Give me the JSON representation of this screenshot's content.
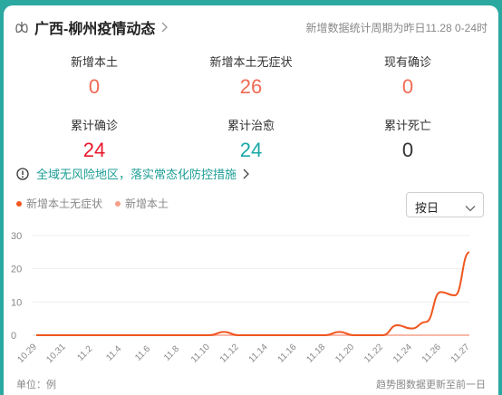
{
  "header": {
    "title": "广西-柳州疫情动态",
    "period": "新增数据统计周期为昨日11.28 0-24时"
  },
  "stats": [
    {
      "label": "新增本土",
      "value": "0",
      "color": "#f06a53"
    },
    {
      "label": "新增本土无症状",
      "value": "26",
      "color": "#f06a53"
    },
    {
      "label": "现有确诊",
      "value": "0",
      "color": "#f06a53"
    },
    {
      "label": "累计确诊",
      "value": "24",
      "color": "#e8192c"
    },
    {
      "label": "累计治愈",
      "value": "24",
      "color": "#1aa8a8"
    },
    {
      "label": "累计死亡",
      "value": "0",
      "color": "#333333"
    }
  ],
  "notice": {
    "text": "全域无风险地区，落实常态化防控措施"
  },
  "select": {
    "value": "按日"
  },
  "chart_data": {
    "type": "line",
    "x_labels": [
      "10.29",
      "10.31",
      "11.2",
      "11.4",
      "11.6",
      "11.8",
      "11.10",
      "11.12",
      "11.14",
      "11.16",
      "11.18",
      "11.20",
      "11.22",
      "11.24",
      "11.26",
      "11.27"
    ],
    "x": [
      "10.29",
      "10.30",
      "10.31",
      "11.1",
      "11.2",
      "11.3",
      "11.4",
      "11.5",
      "11.6",
      "11.7",
      "11.8",
      "11.9",
      "11.10",
      "11.11",
      "11.12",
      "11.13",
      "11.14",
      "11.15",
      "11.16",
      "11.17",
      "11.18",
      "11.19",
      "11.20",
      "11.21",
      "11.22",
      "11.23",
      "11.24",
      "11.25",
      "11.26",
      "11.27"
    ],
    "series": [
      {
        "name": "新增本土无症状",
        "color": "#f0561f",
        "values": [
          0,
          0,
          0,
          0,
          0,
          0,
          0,
          0,
          0,
          0,
          0,
          0,
          0,
          1,
          0,
          0,
          0,
          0,
          0,
          0,
          0,
          1,
          0,
          0,
          0,
          3,
          2,
          4,
          13,
          12,
          25
        ]
      },
      {
        "name": "新增本土",
        "color": "#f6a08a",
        "values": [
          0,
          0,
          0,
          0,
          0,
          0,
          0,
          0,
          0,
          0,
          0,
          0,
          0,
          0,
          0,
          0,
          0,
          0,
          0,
          0,
          0,
          0,
          0,
          0,
          0,
          0,
          0,
          0,
          0,
          0,
          0
        ]
      }
    ],
    "y_ticks": [
      0,
      10,
      20,
      30
    ],
    "ylim": [
      0,
      30
    ]
  },
  "footer": {
    "unit": "单位：例",
    "note": "趋势图数据更新至前一日"
  }
}
